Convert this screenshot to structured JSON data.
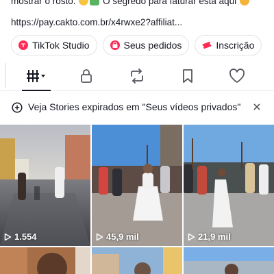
{
  "bio": {
    "line1_text": "mostrar o rosto.",
    "line1_rest": "O segredo para faturar está aqui",
    "link": "https://pay.cakto.com.br/x4rwxe2?affiliat..."
  },
  "chips": [
    {
      "label": "TikTok Studio",
      "icon": "tiktok-studio-icon"
    },
    {
      "label": "Seus pedidos",
      "icon": "shopping-bag-icon"
    },
    {
      "label": "Inscrição",
      "icon": "ticket-icon"
    }
  ],
  "tabs": [
    {
      "name": "videos-grid",
      "icon": "grid-icon"
    },
    {
      "name": "private",
      "icon": "lock-icon"
    },
    {
      "name": "reposts",
      "icon": "repost-icon"
    },
    {
      "name": "favorites",
      "icon": "bookmark-icon"
    },
    {
      "name": "liked",
      "icon": "heart-icon"
    }
  ],
  "banner": {
    "text": "Veja Stories expirados em \"Seus vídeos privados\"",
    "icon": "add-story-icon",
    "close_icon": "close-icon"
  },
  "videos": [
    {
      "views": "1.554"
    },
    {
      "views": "45,9 mil"
    },
    {
      "views": "21,9 mil"
    },
    {
      "views": ""
    },
    {
      "views": ""
    },
    {
      "views": ""
    }
  ],
  "colors": {
    "text": "#161823",
    "chip_accent": "#fe2c55",
    "divider": "#ececee"
  }
}
